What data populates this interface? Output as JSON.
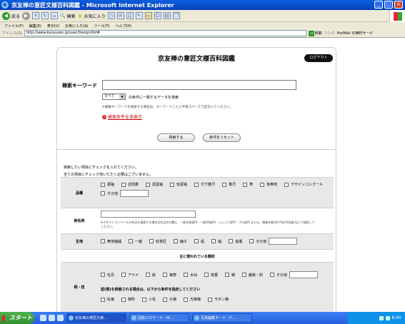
{
  "window": {
    "title": "京友禅の意匠文様百科図鑑 - Microsoft Internet Explorer"
  },
  "toolbar": {
    "back": "戻る",
    "search": "検索",
    "favorites": "お気に入り"
  },
  "menu": [
    "ファイル(F)",
    "編集(E)",
    "表示(V)",
    "お気に入り(A)",
    "ツール(T)",
    "ヘルプ(H)"
  ],
  "address": {
    "label": "アドレス(D)",
    "url": "http://www.kyoyuzen.jp/user/Design/list#",
    "go": "移動",
    "links": "リンク",
    "hotmail": "HotMail の無料サービ"
  },
  "page": {
    "title": "京友禅の意匠文様百科図鑑",
    "logout": "ログアウト",
    "keyword_label": "検索キーワード",
    "select_value": "すべて",
    "condition_text": "の条件に一致するデータを検索",
    "note": "※複数キーワードを検索する場合は、キーワードごとに半角スペースで区切ってください。",
    "hide_conditions": "検索条件を非表示",
    "search_btn": "検索する",
    "reset_btn": "条件をリセット",
    "instruction1": "検索したい項目にチェックを入れてください。",
    "instruction2": "全ての項目にチェック他いただく必要はございません。"
  },
  "form": {
    "hinmoku_label": "品種",
    "hinmoku_options": [
      "振袖",
      "訪問着",
      "黒留袖",
      "色留袖",
      "付下着尺",
      "着尺",
      "帯",
      "色無地",
      "デザインコンクール",
      "その他"
    ],
    "name_label": "制名称",
    "name_note": "※デザインコンクールの作品を検索する場合は作品名の欄に、一般年録部門・一般OB部門・ジュニア部門・プロ部門 または、開催年度(例:平成19年度)などで検索してください。",
    "kiji_label": "生地",
    "kiji_options": [
      "無地縮緬",
      "一越",
      "紋意匠",
      "綸子",
      "絽",
      "紬",
      "塩瀬",
      "その他"
    ],
    "main_colors_head": "主に使われている顔材",
    "colors_options": [
      "牡丹",
      "アヤメ",
      "萩",
      "菊菱",
      "水仙",
      "桔梗",
      "蝶",
      "鹿板・熨",
      "その他"
    ],
    "kata_label": "柄・技",
    "sub_note": "型(柄)を検索される場合は、以下から条件を指定してください",
    "kata_options": [
      "乱菊",
      "御所",
      "小花",
      "大菊",
      "光琳菊",
      "モダン菊"
    ]
  },
  "taskbar": {
    "start": "スタート",
    "tasks": [
      "京友禅の意匠文様...",
      "回転パスワード - M...",
      "写真編集モード - P..."
    ],
    "clock": "8:45"
  }
}
